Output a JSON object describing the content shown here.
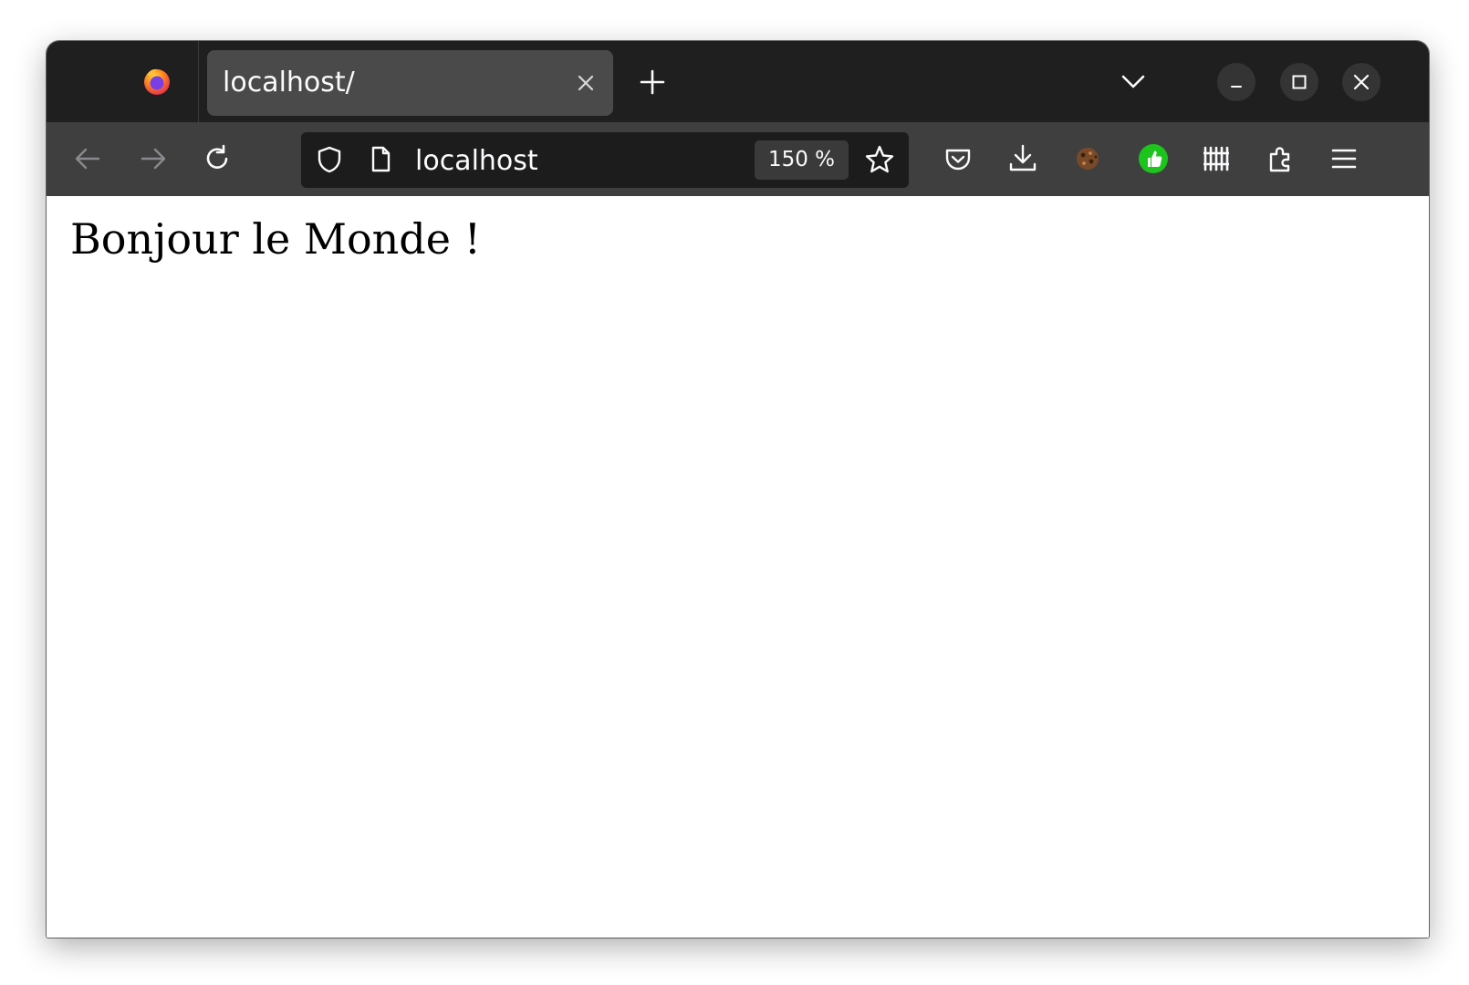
{
  "browser": {
    "tab": {
      "title": "localhost/",
      "close_icon": "close-icon"
    },
    "new_tab_icon": "plus-icon",
    "tab_list_icon": "chevron-down-icon",
    "window_controls": [
      "minimize-icon",
      "maximize-icon",
      "close-icon"
    ],
    "navigation": {
      "back_icon": "arrow-left-icon",
      "forward_icon": "arrow-right-icon",
      "reload_icon": "reload-icon"
    },
    "urlbar": {
      "url": "localhost",
      "zoom": "150 %",
      "security_icon": "shield-icon",
      "page_icon": "page-icon",
      "bookmark_icon": "star-icon"
    },
    "toolbar_icons": [
      "pocket-icon",
      "download-icon",
      "cookie-icon",
      "thumbs-up-extension-icon",
      "library-icon",
      "extensions-icon",
      "menu-icon"
    ],
    "colors": {
      "tabbar": "#1f1f1f",
      "navbar": "#3f3f3f",
      "urlbar": "#1c1c1c",
      "active_tab": "#4a4a4a",
      "extension_green": "#1ec41e"
    }
  },
  "page": {
    "heading": "Bonjour le Monde !"
  }
}
